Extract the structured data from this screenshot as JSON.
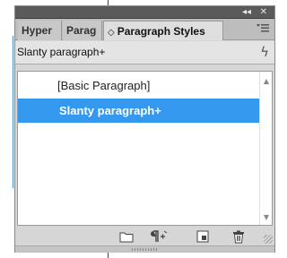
{
  "titlebar": {
    "collapse_label": "◂◂",
    "close_label": "✕"
  },
  "tabs": [
    {
      "label": "Hyper"
    },
    {
      "label": "Parag"
    },
    {
      "label": "Paragraph Styles",
      "arrows": "◇"
    }
  ],
  "panel_menu_icon": "menu-icon",
  "style_bar": {
    "current_style": "Slanty paragraph+",
    "icon": "lightning-icon"
  },
  "styles_list": [
    {
      "label": "[Basic Paragraph]",
      "selected": false
    },
    {
      "label": "Slanty paragraph+",
      "selected": true
    }
  ],
  "footer_buttons": [
    {
      "icon": "folder-icon"
    },
    {
      "icon": "clear-overrides-icon"
    },
    {
      "icon": "new-style-icon"
    },
    {
      "icon": "trash-icon"
    }
  ],
  "colors": {
    "selection": "#3498ee",
    "titlebar": "#5a5a5a",
    "panel": "#d6d6d6"
  }
}
